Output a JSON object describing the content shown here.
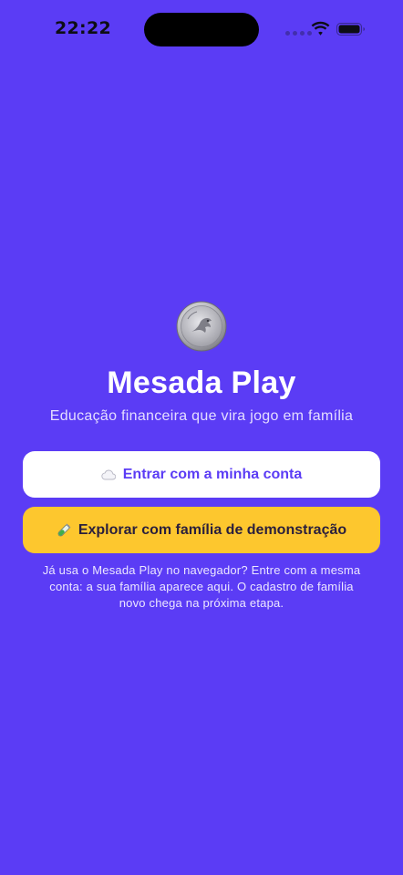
{
  "status_bar": {
    "time": "22:22"
  },
  "app": {
    "title": "Mesada Play",
    "subtitle": "Educação financeira que vira jogo em família",
    "logo_icon": "coin-icon"
  },
  "actions": {
    "login_label": "Entrar com a minha conta",
    "login_icon": "cloud-icon",
    "demo_label": "Explorar com família de demonstração",
    "demo_icon": "test-tube-icon"
  },
  "hint": "Já usa o Mesada Play no navegador? Entre com a mesma conta: a sua família aparece aqui. O cadastro de família novo chega na próxima etapa.",
  "colors": {
    "background": "#5b3cf5",
    "login_button": "#ffffff",
    "demo_button": "#fdc72e",
    "accent_text": "#5b3cf5"
  }
}
